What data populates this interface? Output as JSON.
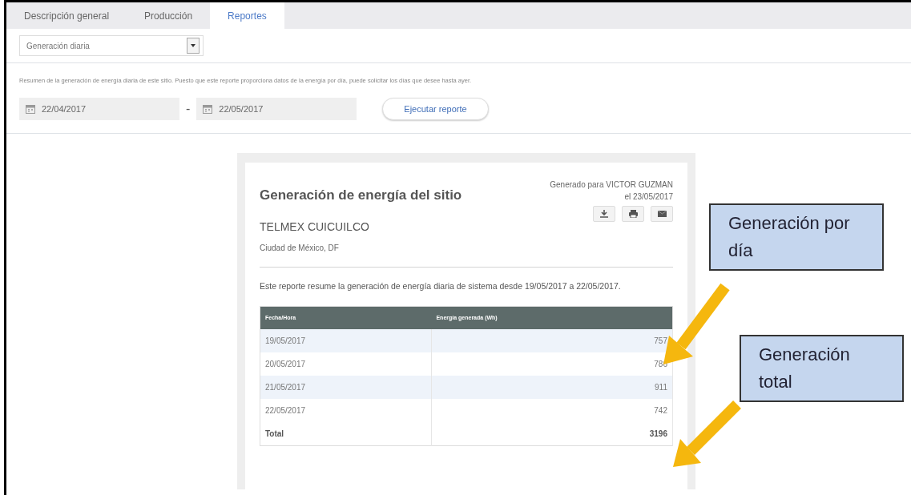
{
  "tabs": [
    {
      "label": "Descripción general",
      "selected": false
    },
    {
      "label": "Producción",
      "selected": false
    },
    {
      "label": "Reportes",
      "selected": true
    }
  ],
  "report_select": {
    "value": "Generación diaria"
  },
  "description": "Resumen de la generación de energía diaria de este sitio. Puesto que este reporte proporciona datos de la energía por día, puede solicitar los días que desee hasta ayer.",
  "date_range": {
    "from": "22/04/2017",
    "separator": "-",
    "to": "22/05/2017"
  },
  "run_button": "Ejecutar reporte",
  "report": {
    "title": "Generación de energía del sitio",
    "generated_for": "Generado para VICTOR GUZMAN",
    "generated_on": "el 23/05/2017",
    "site": "TELMEX CUICUILCO",
    "location": "Ciudad de México, DF",
    "summary": "Este reporte resume la generación de energía diaria de sistema desde 19/05/2017 a 22/05/2017.",
    "columns": [
      "Fecha/Hora",
      "Energía generada (Wh)"
    ],
    "rows": [
      {
        "kind": "day",
        "date": "19/05/2017",
        "value": "757"
      },
      {
        "kind": "day",
        "date": "20/05/2017",
        "value": "786"
      },
      {
        "kind": "day",
        "date": "21/05/2017",
        "value": "911"
      },
      {
        "kind": "day",
        "date": "22/05/2017",
        "value": "742"
      },
      {
        "kind": "total",
        "date": "Total",
        "value": "3196"
      }
    ]
  },
  "callouts": [
    {
      "text": "Generación por día"
    },
    {
      "text": "Generación total"
    }
  ]
}
